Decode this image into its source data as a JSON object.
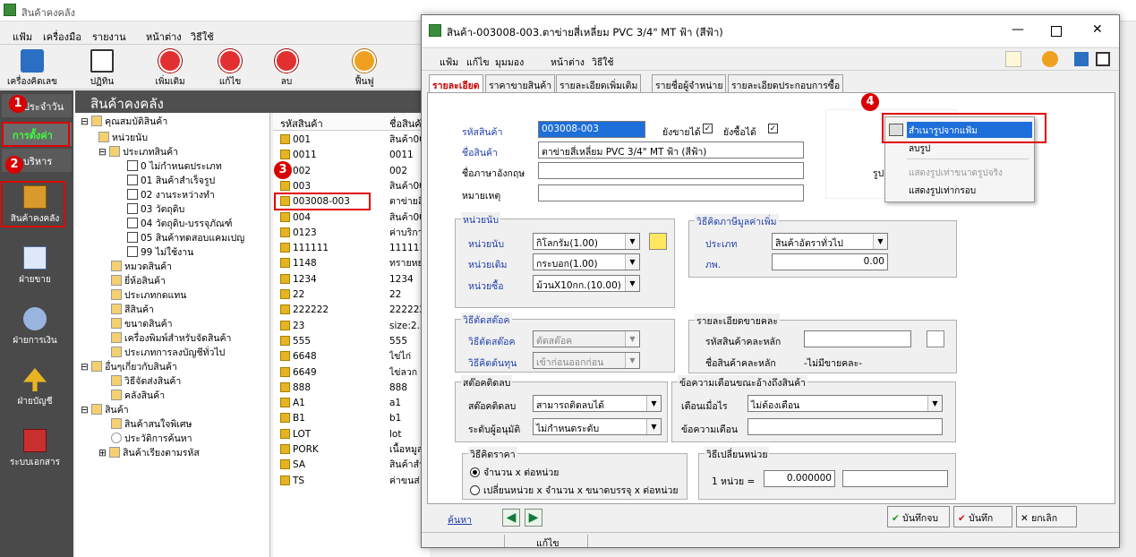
{
  "app": {
    "title": "สินค้าคงคลัง"
  },
  "menu": [
    "แฟ้ม",
    "เครื่องมือ",
    "รายงาน",
    "หน้าต่าง",
    "วิธีใช้"
  ],
  "toolbar": [
    "เครื่องคิดเลข",
    "ปฏิทิน",
    "เพิ่มเติม",
    "แก้ไข",
    "ลบ",
    "ฟื้นฟู"
  ],
  "sidebar": {
    "tab_daily": "ประจำวัน",
    "tab_setup": "การตั้งค่า",
    "tab_admin": "บริหาร",
    "items": [
      "สินค้าคงคลัง",
      "ฝ่ายขาย",
      "ฝ่ายการเงิน",
      "ฝ่ายบัญชี",
      "ระบบเอกสาร"
    ]
  },
  "steps": [
    "1",
    "2",
    "3",
    "4"
  ],
  "panel": {
    "header": "สินค้าคงคลัง"
  },
  "tree": [
    "คุณสมบัติสินค้า",
    "หน่วยนับ",
    "ประเภทสินค้า",
    "0 ไม่กำหนดประเภท",
    "01 สินค้าสำเร็จรูป",
    "02 งานระหว่างทำ",
    "03 วัตถุดิบ",
    "04 วัตถุดิบ-บรรจุภัณฑ์",
    "05 สินค้าทดสอบแคมเปญ",
    "99 ไม่ใช้งาน",
    "หมวดสินค้า",
    "ยี่ห้อสินค้า",
    "ประเภทกดแทน",
    "สีสินค้า",
    "ขนาดสินค้า",
    "เครื่องพิมพ์สำหรับจัดสินค้า",
    "ประเภทการลงบัญชีทั่วไป",
    "อื่นๆเกี่ยวกับสินค้า",
    "วิธีจัดส่งสินค้า",
    "คลังสินค้า",
    "สินค้า",
    "สินค้าสนใจพิเศษ",
    "ประวัติการค้นหา",
    "สินค้าเรียงตามรหัส"
  ],
  "list": {
    "col_code": "รหัสสินค้า",
    "col_name": "ชื่อสินค้า",
    "rows": [
      [
        "001",
        "สินค้า00"
      ],
      [
        "0011",
        "0011"
      ],
      [
        "002",
        "002"
      ],
      [
        "003",
        "สินค้า00"
      ],
      [
        "003008-003",
        "ตาข่ายสี"
      ],
      [
        "004",
        "สินค้า00"
      ],
      [
        "0123",
        "ค่าบริกา"
      ],
      [
        "111111",
        "111111"
      ],
      [
        "1148",
        "ทรายหย"
      ],
      [
        "1234",
        "1234"
      ],
      [
        "22",
        "22"
      ],
      [
        "222222",
        "222222"
      ],
      [
        "23",
        "size:2.5"
      ],
      [
        "555",
        "555"
      ],
      [
        "6648",
        "ไข่ไก่"
      ],
      [
        "6649",
        "ไข่ลวก"
      ],
      [
        "888",
        "888"
      ],
      [
        "A1",
        "a1"
      ],
      [
        "B1",
        "b1"
      ],
      [
        "LOT",
        "lot"
      ],
      [
        "PORK",
        "เนื้อหมูส"
      ],
      [
        "SA",
        "สินค้าสำ"
      ],
      [
        "TS",
        "ค่าขนส่"
      ]
    ]
  },
  "dialog": {
    "title": "สินค้า-003008-003.ตาข่ายสี่เหลี่ยม PVC 3/4\" MT ฟ้า (สีฟ้า)",
    "menu": [
      "แฟ้ม",
      "แก้ไข",
      "มุมมอง",
      "หน้าต่าง",
      "วิธีใช้"
    ],
    "tabs": [
      "รายละเอียด",
      "ราคาขายสินค้า",
      "รายละเอียดเพิ่มเติม",
      "รายชื่อผู้จำหน่าย",
      "รายละเอียดประกอบการซื้อ"
    ],
    "f_code_label": "รหัสสินค้า",
    "f_code": "003008-003",
    "sell_label": "ยังขายได้",
    "buy_label": "ยังซื้อได้",
    "check": "✓",
    "f_name_label": "ชื่อสินค้า",
    "f_name": "ตาข่ายสี่เหลี่ยม PVC 3/4\" MT ฟ้า (สีฟ้า)",
    "f_eng_label": "ชื่อภาษาอังกฤษ",
    "f_note_label": "หมายเหตุ",
    "unit_group": "หน่วยนับ",
    "unit_label": "หน่วยนับ",
    "unit_val": "กิโลกรัม(1.00)",
    "unit_std_label": "หน่วยเดิม",
    "unit_std_val": "กระบอก(1.00)",
    "unit_buy_label": "หน่วยซื้อ",
    "unit_buy_val": "ม้วนX10กก.(10.00)",
    "vat_group": "วิธีคิดภาษีมูลค่าเพิ่ม",
    "vat_type_label": "ประเภท",
    "vat_type_val": "สินค้าอัตราทั่วไป",
    "vat_rate_label": "ภพ.",
    "vat_rate_val": "0.00",
    "stock_group": "วิธีตัดสต๊อค",
    "stock_label": "วิธีตัดสต๊อค",
    "stock_val": "ตัดสต๊อค",
    "cost_label": "วิธีคิดต้นทุน",
    "cost_val": "เข้าก่อนออกก่อน",
    "sale_group": "รายละเอียดขายคละ",
    "mix_code_label": "รหัสสินค้าคละหลัก",
    "mix_name_label": "ชื่อสินค้าคละหลัก",
    "mix_name_val": "-ไม่มีขายคละ-",
    "neg_group": "สต๊อคติดลบ",
    "neg_label": "สต๊อคติดลบ",
    "neg_val": "สามารถติดลบได้",
    "approve_label": "ระดับผู้อนุมัติ",
    "approve_val": "ไม่กำหนดระดับ",
    "warn_group": "ข้อความเตือนขณะอ้างถึงสินค้า",
    "warn_when_label": "เตือนเมื่อไร",
    "warn_when_val": "ไม่ต้องเตือน",
    "warn_msg_label": "ข้อความเตือน",
    "price_group": "วิธีคิดราคา",
    "price_opt1": "จำนวน x ต่อหน่วย",
    "price_opt2": "เปลี่ยนหน่วย x จำนวน x ขนาดบรรจุ x ต่อหน่วย",
    "conv_group": "วิธีเปลี่ยนหน่วย",
    "conv_label": "1 หน่วย =",
    "conv_val": "0.000000",
    "img_label": "รูปสิ",
    "search_link": "ค้นหา",
    "btn_save_close": "บันทึกจบ",
    "btn_save": "บันทึก",
    "btn_cancel": "ยกเลิก",
    "status": "แก้ไข"
  },
  "context_menu": [
    "สำเนารูปจากแฟ้ม",
    "ลบรูป",
    "แสดงรูปเท่าขนาดรูปจริง",
    "แสดงรูปเท่ากรอบ"
  ],
  "colors": {
    "highlight": "#e00000",
    "select": "#1e6fd9",
    "dark_header": "#4f4f4f",
    "sidebar": "#4a4a4a"
  }
}
